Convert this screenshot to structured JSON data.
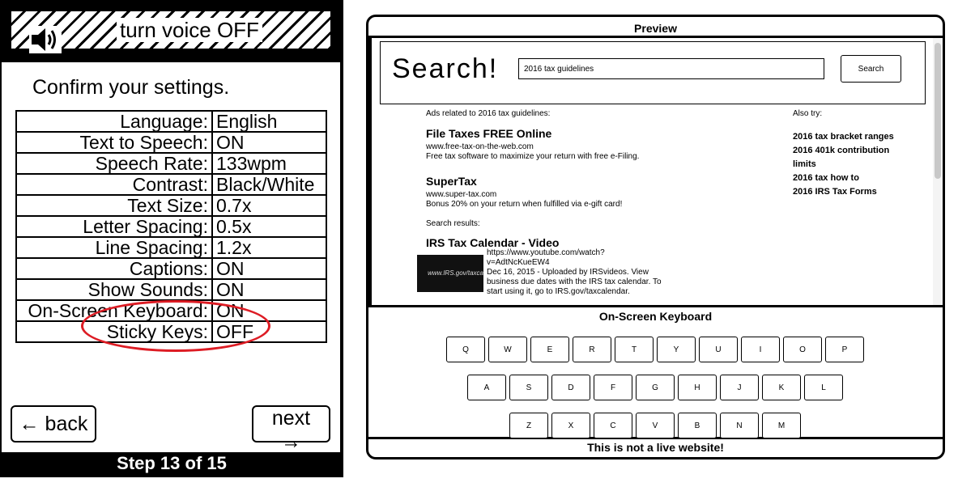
{
  "voice_bar": {
    "label": "turn voice OFF",
    "icon": "speaker-icon"
  },
  "confirm": {
    "title": "Confirm your settings.",
    "settings": [
      {
        "label": "Language:",
        "value": "English"
      },
      {
        "label": "Text to Speech:",
        "value": "ON"
      },
      {
        "label": "Speech Rate:",
        "value": "133wpm"
      },
      {
        "label": "Contrast:",
        "value": "Black/White"
      },
      {
        "label": "Text Size:",
        "value": "0.7x"
      },
      {
        "label": "Letter Spacing:",
        "value": "0.5x"
      },
      {
        "label": "Line Spacing:",
        "value": "1.2x"
      },
      {
        "label": "Captions:",
        "value": "ON"
      },
      {
        "label": "Show Sounds:",
        "value": "ON"
      },
      {
        "label": "On-Screen Keyboard:",
        "value": "ON"
      },
      {
        "label": "Sticky Keys:",
        "value": "OFF"
      }
    ],
    "highlight_color": "#dd1c24"
  },
  "nav": {
    "back_label": "← back",
    "next_label": "next →",
    "step": "Step 13 of 15"
  },
  "preview": {
    "header": "Preview",
    "logo": "Search!",
    "search_value": "2016 tax guidelines",
    "search_button": "Search",
    "ads_heading": "Ads related to 2016 tax guidelines:",
    "ads": [
      {
        "title": "File Taxes FREE Online",
        "url": "www.free-tax-on-the-web.com",
        "desc": "Free tax software to maximize your return with free e-Filing."
      },
      {
        "title": "SuperTax",
        "url": "www.super-tax.com",
        "desc": "Bonus 20% on your return when fulfilled via e-gift card!"
      }
    ],
    "results_heading": "Search results:",
    "result": {
      "title": "IRS Tax Calendar - Video",
      "url_line1": "https://www.youtube.com/watch?",
      "url_line2": "v=AdtNcKueEW4",
      "desc_line1": "Dec 16, 2015 - Uploaded by IRSvideos. View",
      "desc_line2": "business due dates with the IRS tax calendar. To",
      "desc_line3": "start using it, go to IRS.gov/taxcalendar.",
      "thumb_text": "www.IRS.gov/taxca"
    },
    "also_try": {
      "heading": "Also try:",
      "links": [
        "2016 tax bracket ranges",
        "2016 401k contribution",
        "limits",
        "2016 tax how to",
        "2016 IRS Tax Forms"
      ]
    }
  },
  "keyboard": {
    "title": "On-Screen Keyboard",
    "rows": [
      [
        "Q",
        "W",
        "E",
        "R",
        "T",
        "Y",
        "U",
        "I",
        "O",
        "P"
      ],
      [
        "A",
        "S",
        "D",
        "F",
        "G",
        "H",
        "J",
        "K",
        "L"
      ],
      [
        "Z",
        "X",
        "C",
        "V",
        "B",
        "N",
        "M"
      ]
    ]
  },
  "footer": "This is not a live website!"
}
